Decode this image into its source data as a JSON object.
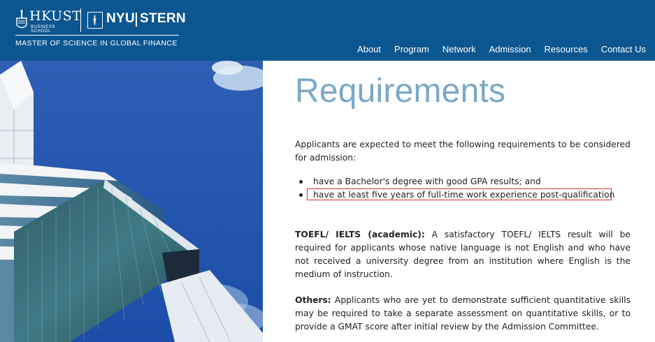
{
  "header": {
    "hkust_name": "HKUST",
    "hkust_sub": "BUSINESS SCHOOL",
    "nyu_name": "NYU",
    "stern_name": "STERN",
    "program_name": "MASTER OF SCIENCE IN GLOBAL FINANCE",
    "background_color": "#0b5690"
  },
  "nav": {
    "items": [
      {
        "label": "About"
      },
      {
        "label": "Program"
      },
      {
        "label": "Network"
      },
      {
        "label": "Admission"
      },
      {
        "label": "Resources"
      },
      {
        "label": "Contact Us"
      }
    ]
  },
  "main": {
    "title": "Requirements",
    "intro": "Applicants are expected to meet the following requirements to be considered for admission:",
    "requirements": [
      {
        "text": "have a Bachelor's degree with good GPA results; and"
      },
      {
        "text": "have at least five years of full-time work experience post-qualification"
      }
    ],
    "toefl_label": "TOEFL/ IELTS (academic):",
    "toefl_text": " A satisfactory TOEFL/ IELTS result will be required for applicants whose native language is not English and who have not received a university degree from an institution where English is the medium of instruction.",
    "others_label": "Others:",
    "others_text": " Applicants who are yet to demonstrate sufficient quantitative skills may be required to take a separate assessment on quantitative skills, or to provide a GMAT score after initial review by the Admission Committee.",
    "title_color": "#7aa8c8",
    "highlight_color": "#d62f2f"
  }
}
